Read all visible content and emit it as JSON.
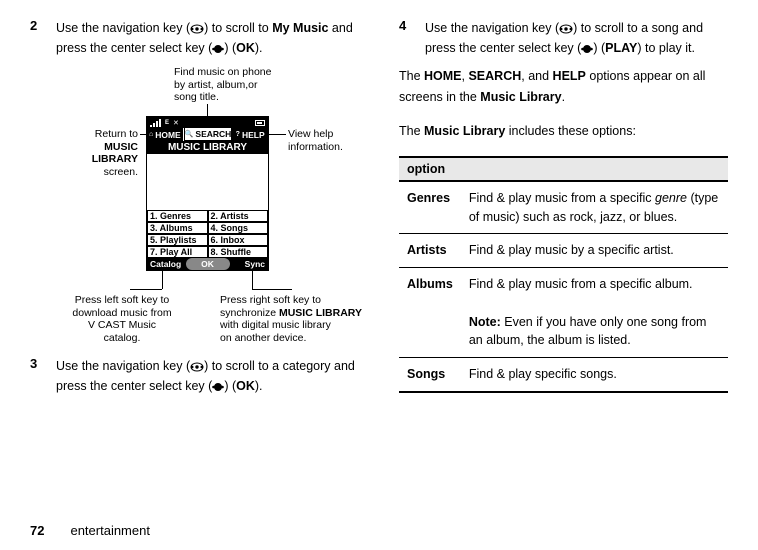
{
  "steps": {
    "s2": {
      "num": "2",
      "text_a": "Use the navigation key (",
      "text_b": ") to scroll to ",
      "target": "My Music",
      "text_c": " and press the center select key (",
      "text_d": ") (",
      "action": "OK",
      "text_e": ")."
    },
    "s3": {
      "num": "3",
      "text_a": "Use the navigation key (",
      "text_b": ") to scroll to a category and press the center select key (",
      "text_c": ") (",
      "action": "OK",
      "text_d": ")."
    },
    "s4": {
      "num": "4",
      "text_a": "Use the navigation key (",
      "text_b": ") to scroll to a song and press the center select key (",
      "text_c": ") (",
      "action": "PLAY",
      "text_d": ") to play it."
    }
  },
  "callouts": {
    "top": {
      "l1": "Find music on phone",
      "l2": "by artist, album,or",
      "l3": "song title."
    },
    "left": {
      "l1": "Return to",
      "l2": "MUSIC LIBRARY",
      "l3": "screen."
    },
    "right": {
      "l1": "View help",
      "l2": "information."
    },
    "bl": {
      "l1": "Press left soft key to",
      "l2": "download music from",
      "l3": "V CAST Music",
      "l4": "catalog."
    },
    "br": {
      "l1": "Press right soft key to",
      "l2": "synchronize ",
      "l2b": "MUSIC LIBRARY",
      "l3": "with digital music library",
      "l4": "on another device."
    }
  },
  "phone": {
    "home": "HOME",
    "search": "SEARCH",
    "help": "HELP",
    "title": "MUSIC LIBRARY",
    "cells": [
      "1. Genres",
      "2. Artists",
      "3. Albums",
      "4. Songs",
      "5. Playlists",
      "6. Inbox",
      "7. Play All",
      "8. Shuffle"
    ],
    "soft_l": "Catalog",
    "soft_c": "OK",
    "soft_r": "Sync"
  },
  "right": {
    "p1_a": "The ",
    "p1_b": "HOME",
    "p1_c": ", ",
    "p1_d": "SEARCH",
    "p1_e": ", and ",
    "p1_f": "HELP",
    "p1_g": " options appear on all screens in the ",
    "p1_h": "Music Library",
    "p1_i": ".",
    "p2_a": "The ",
    "p2_b": "Music Library",
    "p2_c": " includes these options:"
  },
  "table": {
    "header": "option",
    "rows": [
      {
        "k": "Genres",
        "v_a": "Find & play music from a specific ",
        "v_em": "genre",
        "v_b": " (type of music) such as rock, jazz, or blues."
      },
      {
        "k": "Artists",
        "v_a": "Find & play music by a specific artist."
      },
      {
        "k": "Albums",
        "v_a": "Find & play music from a specific album.",
        "note_l": "Note:",
        "note_t": " Even if you have only one song from an album, the album is listed."
      },
      {
        "k": "Songs",
        "v_a": "Find & play specific songs."
      }
    ]
  },
  "footer": {
    "page": "72",
    "section": "entertainment"
  }
}
